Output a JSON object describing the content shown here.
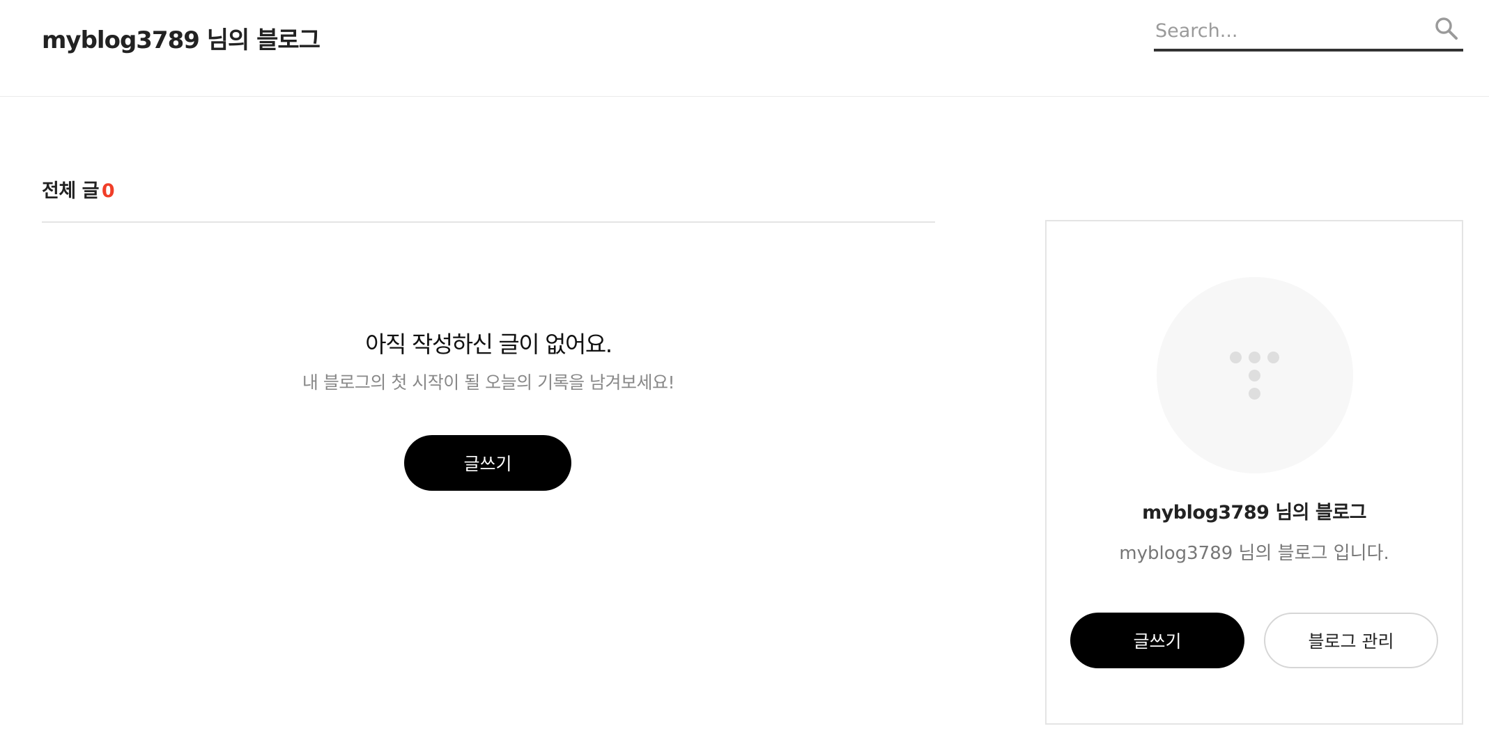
{
  "header": {
    "blog_title": "myblog3789 님의 블로그",
    "search_placeholder": "Search...",
    "search_icon": "search-icon"
  },
  "main": {
    "post_count_label": "전체 글",
    "post_count": "0",
    "empty_title": "아직 작성하신 글이 없어요.",
    "empty_description": "내 블로그의 첫 시작이 될 오늘의 기록을 남겨보세요!",
    "write_button": "글쓰기"
  },
  "sidebar": {
    "avatar_icon": "default-avatar-icon",
    "profile_name": "myblog3789 님의 블로그",
    "profile_description": "myblog3789 님의 블로그 입니다.",
    "write_button": "글쓰기",
    "manage_button": "블로그 관리"
  },
  "colors": {
    "accent_count": "#f03e28",
    "primary_button": "#000000",
    "divider": "#e4e4e4"
  }
}
